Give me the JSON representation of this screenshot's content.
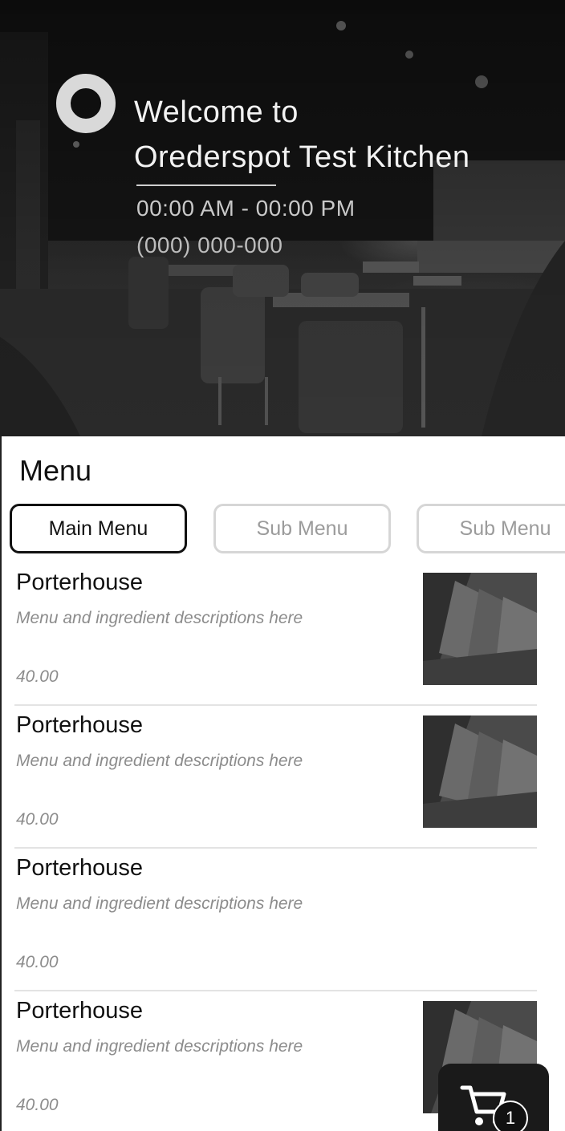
{
  "hero": {
    "welcome_line1": "Welcome to",
    "welcome_line2": "Orederspot Test Kitchen",
    "hours": "00:00 AM - 00:00 PM",
    "phone": "(000) 000-000"
  },
  "menu": {
    "title": "Menu",
    "tabs": [
      {
        "label": "Main Menu",
        "active": true
      },
      {
        "label": "Sub Menu",
        "active": false
      },
      {
        "label": "Sub Menu",
        "active": false
      }
    ],
    "items": [
      {
        "name": "Porterhouse",
        "description": "Menu and ingredient descriptions here",
        "price": "40.00",
        "has_image": true
      },
      {
        "name": "Porterhouse",
        "description": "Menu and ingredient descriptions here",
        "price": "40.00",
        "has_image": true
      },
      {
        "name": "Porterhouse",
        "description": "Menu and ingredient descriptions here",
        "price": "40.00",
        "has_image": false
      },
      {
        "name": "Porterhouse",
        "description": "Menu and ingredient descriptions here",
        "price": "40.00",
        "has_image": true
      }
    ]
  },
  "cart": {
    "icon": "cart-icon",
    "count": "1"
  },
  "colors": {
    "accent": "#111111",
    "tab_inactive_border": "#d6d6d6",
    "muted_text": "#8c8c8c"
  }
}
